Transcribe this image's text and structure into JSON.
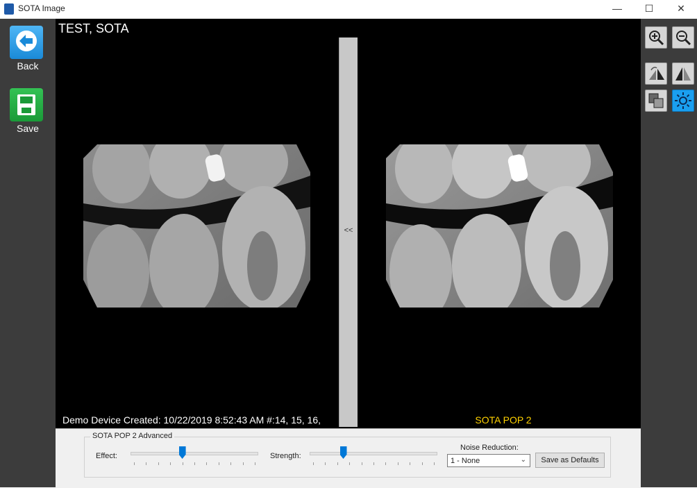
{
  "window": {
    "title": "SOTA Image",
    "minimize": "—",
    "maximize": "☐",
    "close": "✕"
  },
  "left_toolbar": {
    "back_label": "Back",
    "save_label": "Save"
  },
  "viewer": {
    "patient_name": "TEST, SOTA",
    "splitter_label": "<<",
    "left_caption": "Demo Device Created: 10/22/2019 8:52:43 AM #:14, 15, 16,",
    "right_caption": "SOTA POP 2",
    "right_caption_color": "#ffd200"
  },
  "right_toolbar": {
    "icons": [
      "zoom-in-icon",
      "zoom-out-icon",
      "flip-horizontal-icon",
      "mirror-icon",
      "layers-icon",
      "brightness-icon"
    ],
    "active_icon": "brightness-icon"
  },
  "adjustments": {
    "group_title": "SOTA POP 2 Advanced",
    "effect_label": "Effect:",
    "effect_value": 0.4,
    "strength_label": "Strength:",
    "strength_value": 0.25,
    "noise_label": "Noise Reduction:",
    "noise_value": "1 - None",
    "save_defaults_label": "Save as Defaults"
  },
  "colors": {
    "accent": "#0078d7",
    "active_tool": "#1a9ff0"
  }
}
